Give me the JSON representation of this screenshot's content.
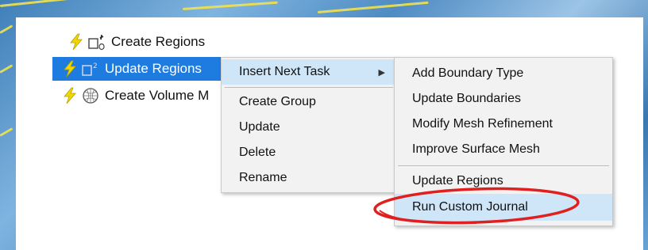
{
  "tree": {
    "items": [
      {
        "label": "Create Regions"
      },
      {
        "label": "Update Regions"
      },
      {
        "label": "Create Volume M"
      }
    ]
  },
  "context_menu": {
    "items": [
      {
        "label": "Insert Next Task"
      },
      {
        "label": "Create Group"
      },
      {
        "label": "Update"
      },
      {
        "label": "Delete"
      },
      {
        "label": "Rename"
      }
    ]
  },
  "submenu": {
    "items": [
      {
        "label": "Add Boundary Type"
      },
      {
        "label": "Update Boundaries"
      },
      {
        "label": "Modify Mesh Refinement"
      },
      {
        "label": "Improve Surface Mesh"
      },
      {
        "label": "Update Regions"
      },
      {
        "label": "Run Custom Journal"
      }
    ]
  },
  "colors": {
    "selection": "#1e7be0",
    "menu_hover": "#cfe6f8",
    "highlight_ring": "#e02020",
    "bolt": "#f2d600"
  },
  "icons": [
    "lightning-bolt-icon",
    "task-region-icon",
    "mesh-sphere-icon",
    "submenu-arrow-icon"
  ]
}
